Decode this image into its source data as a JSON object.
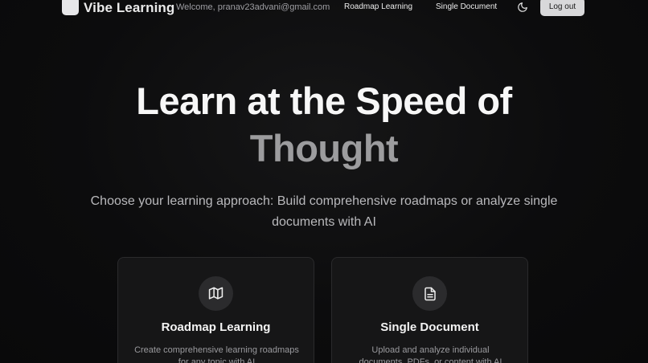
{
  "header": {
    "brand": "Vibe Learning",
    "welcome": "Welcome, pranav23advani@gmail.com",
    "nav": [
      {
        "label": "Roadmap Learning"
      },
      {
        "label": "Single Document"
      }
    ],
    "theme_icon": "moon-icon",
    "logout_label": "Log out"
  },
  "hero": {
    "line1": "Learn at the Speed of",
    "line2": "Thought",
    "subtitle": "Choose your learning approach: Build comprehensive roadmaps or analyze single documents with AI"
  },
  "cards": [
    {
      "icon": "map-icon",
      "title": "Roadmap Learning",
      "description": "Create comprehensive learning roadmaps for any topic with AI"
    },
    {
      "icon": "file-text-icon",
      "title": "Single Document",
      "description": "Upload and analyze individual documents, PDFs, or content with AI"
    }
  ],
  "colors": {
    "background": "#0b0b0c",
    "card": "#161617",
    "accent_muted": "#9c9c9e",
    "logout_bg": "#d8d8da"
  }
}
